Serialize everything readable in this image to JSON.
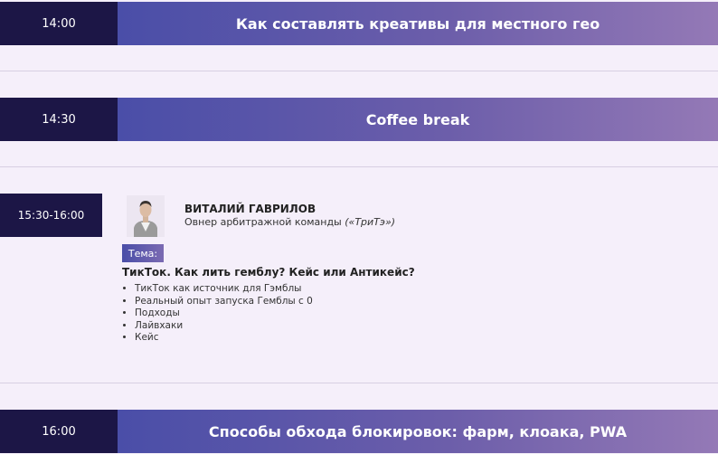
{
  "schedule": [
    {
      "time": "14:00",
      "title": "Как составлять креативы для местного гео"
    },
    {
      "time": "14:30",
      "title": "Coffee break"
    },
    {
      "time": "16:00",
      "title": "Способы обхода блокировок: фарм, клоака, PWA"
    }
  ],
  "session": {
    "time": "15:30-16:00",
    "speaker_name": "ВИТАЛИЙ ГАВРИЛОВ",
    "speaker_role": "Овнер арбитражной команды",
    "speaker_company": "(«ТриТэ»)",
    "theme_label": "Тема:",
    "talk_title": "ТикТок. Как лить гемблу? Кейс или Антикейс?",
    "points": [
      "ТикТок как источник для Гэмблы",
      "Реальный опыт запуска Гемблы с 0",
      "Подходы",
      "Лайвхаки",
      "Кейс"
    ]
  }
}
